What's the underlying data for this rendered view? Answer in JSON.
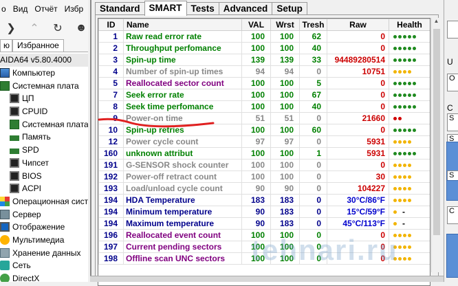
{
  "left_panel": {
    "menu": [
      "о",
      "Вид",
      "Отчёт",
      "Избр"
    ],
    "tabs": [
      "ю",
      "Избранное"
    ],
    "version": "AIDA64 v5.80.4000",
    "tree": [
      {
        "label": "Компьютер",
        "icon": "computer-icon",
        "level": 1
      },
      {
        "label": "Системная плата",
        "icon": "motherboard-icon",
        "level": 1
      },
      {
        "label": "ЦП",
        "icon": "cpu-icon",
        "level": 2
      },
      {
        "label": "CPUID",
        "icon": "cpu-icon",
        "level": 2
      },
      {
        "label": "Системная плата",
        "icon": "motherboard-icon",
        "level": 2
      },
      {
        "label": "Память",
        "icon": "memory-icon",
        "level": 2
      },
      {
        "label": "SPD",
        "icon": "memory-icon",
        "level": 2
      },
      {
        "label": "Чипсет",
        "icon": "chipset-icon",
        "level": 2
      },
      {
        "label": "BIOS",
        "icon": "bios-icon",
        "level": 2
      },
      {
        "label": "ACPI",
        "icon": "acpi-icon",
        "level": 2
      },
      {
        "label": "Операционная система",
        "icon": "os-icon",
        "level": 1
      },
      {
        "label": "Сервер",
        "icon": "server-icon",
        "level": 1
      },
      {
        "label": "Отображение",
        "icon": "display-icon",
        "level": 1
      },
      {
        "label": "Мультимедиа",
        "icon": "multimedia-icon",
        "level": 1
      },
      {
        "label": "Хранение данных",
        "icon": "storage-icon",
        "level": 1
      },
      {
        "label": "Сеть",
        "icon": "network-icon",
        "level": 1
      },
      {
        "label": "DirectX",
        "icon": "directx-icon",
        "level": 1
      }
    ]
  },
  "tabs": [
    "Standard",
    "SMART",
    "Tests",
    "Advanced",
    "Setup"
  ],
  "active_tab": "SMART",
  "columns": [
    "ID",
    "Name",
    "VAL",
    "Wrst",
    "Tresh",
    "Raw",
    "Health"
  ],
  "rows": [
    {
      "id": "1",
      "name": "Raw read error rate",
      "val": "100",
      "wrst": "100",
      "tresh": "62",
      "raw": "0",
      "health": [
        "g",
        "g",
        "g",
        "g",
        "g"
      ],
      "style": "g"
    },
    {
      "id": "2",
      "name": "Throughput perfomance",
      "val": "100",
      "wrst": "100",
      "tresh": "40",
      "raw": "0",
      "health": [
        "g",
        "g",
        "g",
        "g",
        "g"
      ],
      "style": "g"
    },
    {
      "id": "3",
      "name": "Spin-up time",
      "val": "139",
      "wrst": "139",
      "tresh": "33",
      "raw": "94489280514",
      "health": [
        "g",
        "g",
        "g",
        "g",
        "g"
      ],
      "style": "g"
    },
    {
      "id": "4",
      "name": "Number of spin-up times",
      "val": "94",
      "wrst": "94",
      "tresh": "0",
      "raw": "10751",
      "health": [
        "y",
        "y",
        "y",
        "y"
      ],
      "style": "y"
    },
    {
      "id": "5",
      "name": "Reallocated sector count",
      "val": "100",
      "wrst": "100",
      "tresh": "5",
      "raw": "0",
      "health": [
        "g",
        "g",
        "g",
        "g",
        "g"
      ],
      "style": "p"
    },
    {
      "id": "7",
      "name": "Seek error rate",
      "val": "100",
      "wrst": "100",
      "tresh": "67",
      "raw": "0",
      "health": [
        "g",
        "g",
        "g",
        "g",
        "g"
      ],
      "style": "g"
    },
    {
      "id": "8",
      "name": "Seek time perfomance",
      "val": "100",
      "wrst": "100",
      "tresh": "40",
      "raw": "0",
      "health": [
        "g",
        "g",
        "g",
        "g",
        "g"
      ],
      "style": "g"
    },
    {
      "id": "9",
      "name": "Power-on time",
      "val": "51",
      "wrst": "51",
      "tresh": "0",
      "raw": "21660",
      "health": [
        "r",
        "r"
      ],
      "style": "y"
    },
    {
      "id": "10",
      "name": "Spin-up retries",
      "val": "100",
      "wrst": "100",
      "tresh": "60",
      "raw": "0",
      "health": [
        "g",
        "g",
        "g",
        "g",
        "g"
      ],
      "style": "g"
    },
    {
      "id": "12",
      "name": "Power cycle count",
      "val": "97",
      "wrst": "97",
      "tresh": "0",
      "raw": "5931",
      "health": [
        "y",
        "y",
        "y",
        "y"
      ],
      "style": "y"
    },
    {
      "id": "160",
      "name": "unknown attribut",
      "val": "100",
      "wrst": "100",
      "tresh": "1",
      "raw": "5931",
      "health": [
        "g",
        "g",
        "g",
        "g",
        "g"
      ],
      "style": "g"
    },
    {
      "id": "191",
      "name": "G-SENSOR shock counter",
      "val": "100",
      "wrst": "100",
      "tresh": "0",
      "raw": "0",
      "health": [
        "y",
        "y",
        "y",
        "y"
      ],
      "style": "y"
    },
    {
      "id": "192",
      "name": "Power-off retract count",
      "val": "100",
      "wrst": "100",
      "tresh": "0",
      "raw": "30",
      "health": [
        "y",
        "y",
        "y",
        "y"
      ],
      "style": "y"
    },
    {
      "id": "193",
      "name": "Load/unload cycle count",
      "val": "90",
      "wrst": "90",
      "tresh": "0",
      "raw": "104227",
      "health": [
        "y",
        "y",
        "y",
        "y"
      ],
      "style": "y"
    },
    {
      "id": "194",
      "name": "HDA Temperature",
      "val": "183",
      "wrst": "183",
      "tresh": "0",
      "raw": "30°C/86°F",
      "health": [
        "y",
        "y",
        "y",
        "y"
      ],
      "style": "u",
      "raw_blue": true
    },
    {
      "id": "194",
      "name": "Minimum temperature",
      "val": "90",
      "wrst": "183",
      "tresh": "0",
      "raw": "15°C/59°F",
      "health": [
        "y"
      ],
      "health_text": "-",
      "style": "u",
      "raw_blue": true
    },
    {
      "id": "194",
      "name": "Maximum temperature",
      "val": "90",
      "wrst": "183",
      "tresh": "0",
      "raw": "45°C/113°F",
      "health": [
        "y"
      ],
      "health_text": "-",
      "style": "u",
      "raw_blue": true
    },
    {
      "id": "196",
      "name": "Reallocated event count",
      "val": "100",
      "wrst": "100",
      "tresh": "0",
      "raw": "0",
      "health": [
        "y",
        "y",
        "y",
        "y"
      ],
      "style": "p"
    },
    {
      "id": "197",
      "name": "Current pending sectors",
      "val": "100",
      "wrst": "100",
      "tresh": "0",
      "raw": "0",
      "health": [
        "y",
        "y",
        "y",
        "y"
      ],
      "style": "p"
    },
    {
      "id": "198",
      "name": "Offline scan UNC sectors",
      "val": "100",
      "wrst": "100",
      "tresh": "0",
      "raw": "0",
      "health": [
        "y",
        "y",
        "y",
        "y"
      ],
      "style": "p"
    }
  ],
  "right_panel": {
    "labels": [
      "U",
      "O",
      "S",
      "S",
      "S"
    ]
  },
  "watermark": "tehnari.ru",
  "colors": {
    "ok": "#1f8a1f",
    "warn": "#f2b400",
    "bad": "#d00000",
    "annotation": "#e02020"
  }
}
